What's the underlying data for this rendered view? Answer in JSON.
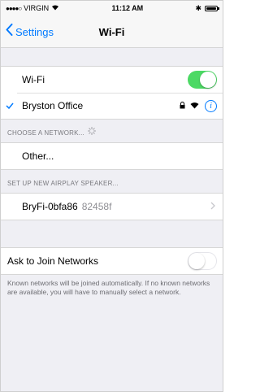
{
  "status_bar": {
    "signal": "●●●●○",
    "carrier": "VIRGIN",
    "time": "11:12 AM",
    "bluetooth": "✱"
  },
  "nav": {
    "back_label": "Settings",
    "title": "Wi-Fi"
  },
  "wifi": {
    "label": "Wi-Fi",
    "enabled": true,
    "connected_network": "Bryston Office"
  },
  "networks": {
    "header": "CHOOSE A NETWORK...",
    "other_label": "Other..."
  },
  "airplay": {
    "header": "SET UP NEW AIRPLAY SPEAKER...",
    "speaker_name": "BryFi-0bfa86",
    "speaker_id": "82458f"
  },
  "ask_to_join": {
    "label": "Ask to Join Networks",
    "enabled": false,
    "description": "Known networks will be joined automatically. If no known networks are available, you will have to manually select a network."
  },
  "colors": {
    "accent": "#007aff",
    "toggle_on": "#4cd964",
    "background": "#efeff4"
  }
}
